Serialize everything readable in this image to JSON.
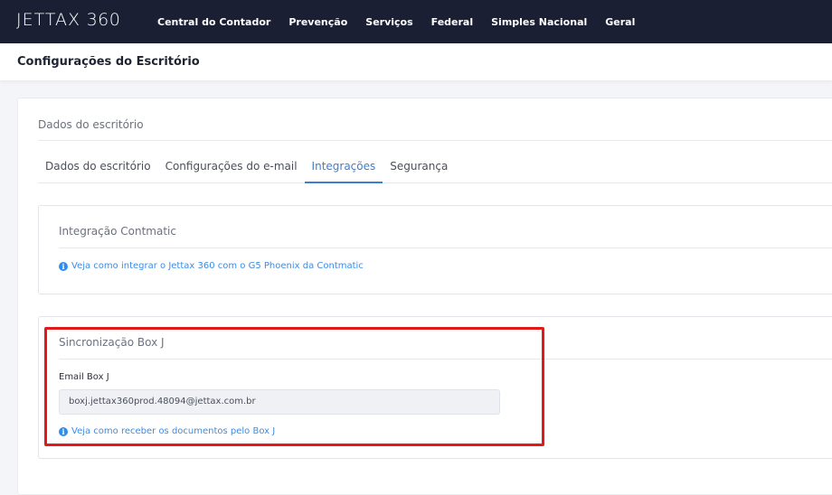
{
  "navbar": {
    "logo_main": "JETTAX",
    "logo_num": "360",
    "items": [
      "Central do Contador",
      "Prevenção",
      "Serviços",
      "Federal",
      "Simples Nacional",
      "Geral"
    ]
  },
  "page": {
    "title": "Configurações do Escritório"
  },
  "card": {
    "title": "Dados do escritório",
    "tabs": [
      "Dados do escritório",
      "Configurações do e-mail",
      "Integrações",
      "Segurança"
    ],
    "active_tab": "Integrações"
  },
  "contmatic": {
    "title": "Integração Contmatic",
    "link": "Veja como integrar o Jettax 360 com o G5 Phoenix da Contmatic",
    "icon": "info-icon"
  },
  "boxj": {
    "title": "Sincronização Box J",
    "field_label": "Email Box J",
    "field_value": "boxj.jettax360prod.48094@jettax.com.br",
    "link": "Veja como receber os documentos pelo Box J",
    "icon": "info-icon"
  },
  "colors": {
    "navbar": "#1b1f33",
    "accent": "#3a7fd3",
    "highlight": "#e01919"
  }
}
